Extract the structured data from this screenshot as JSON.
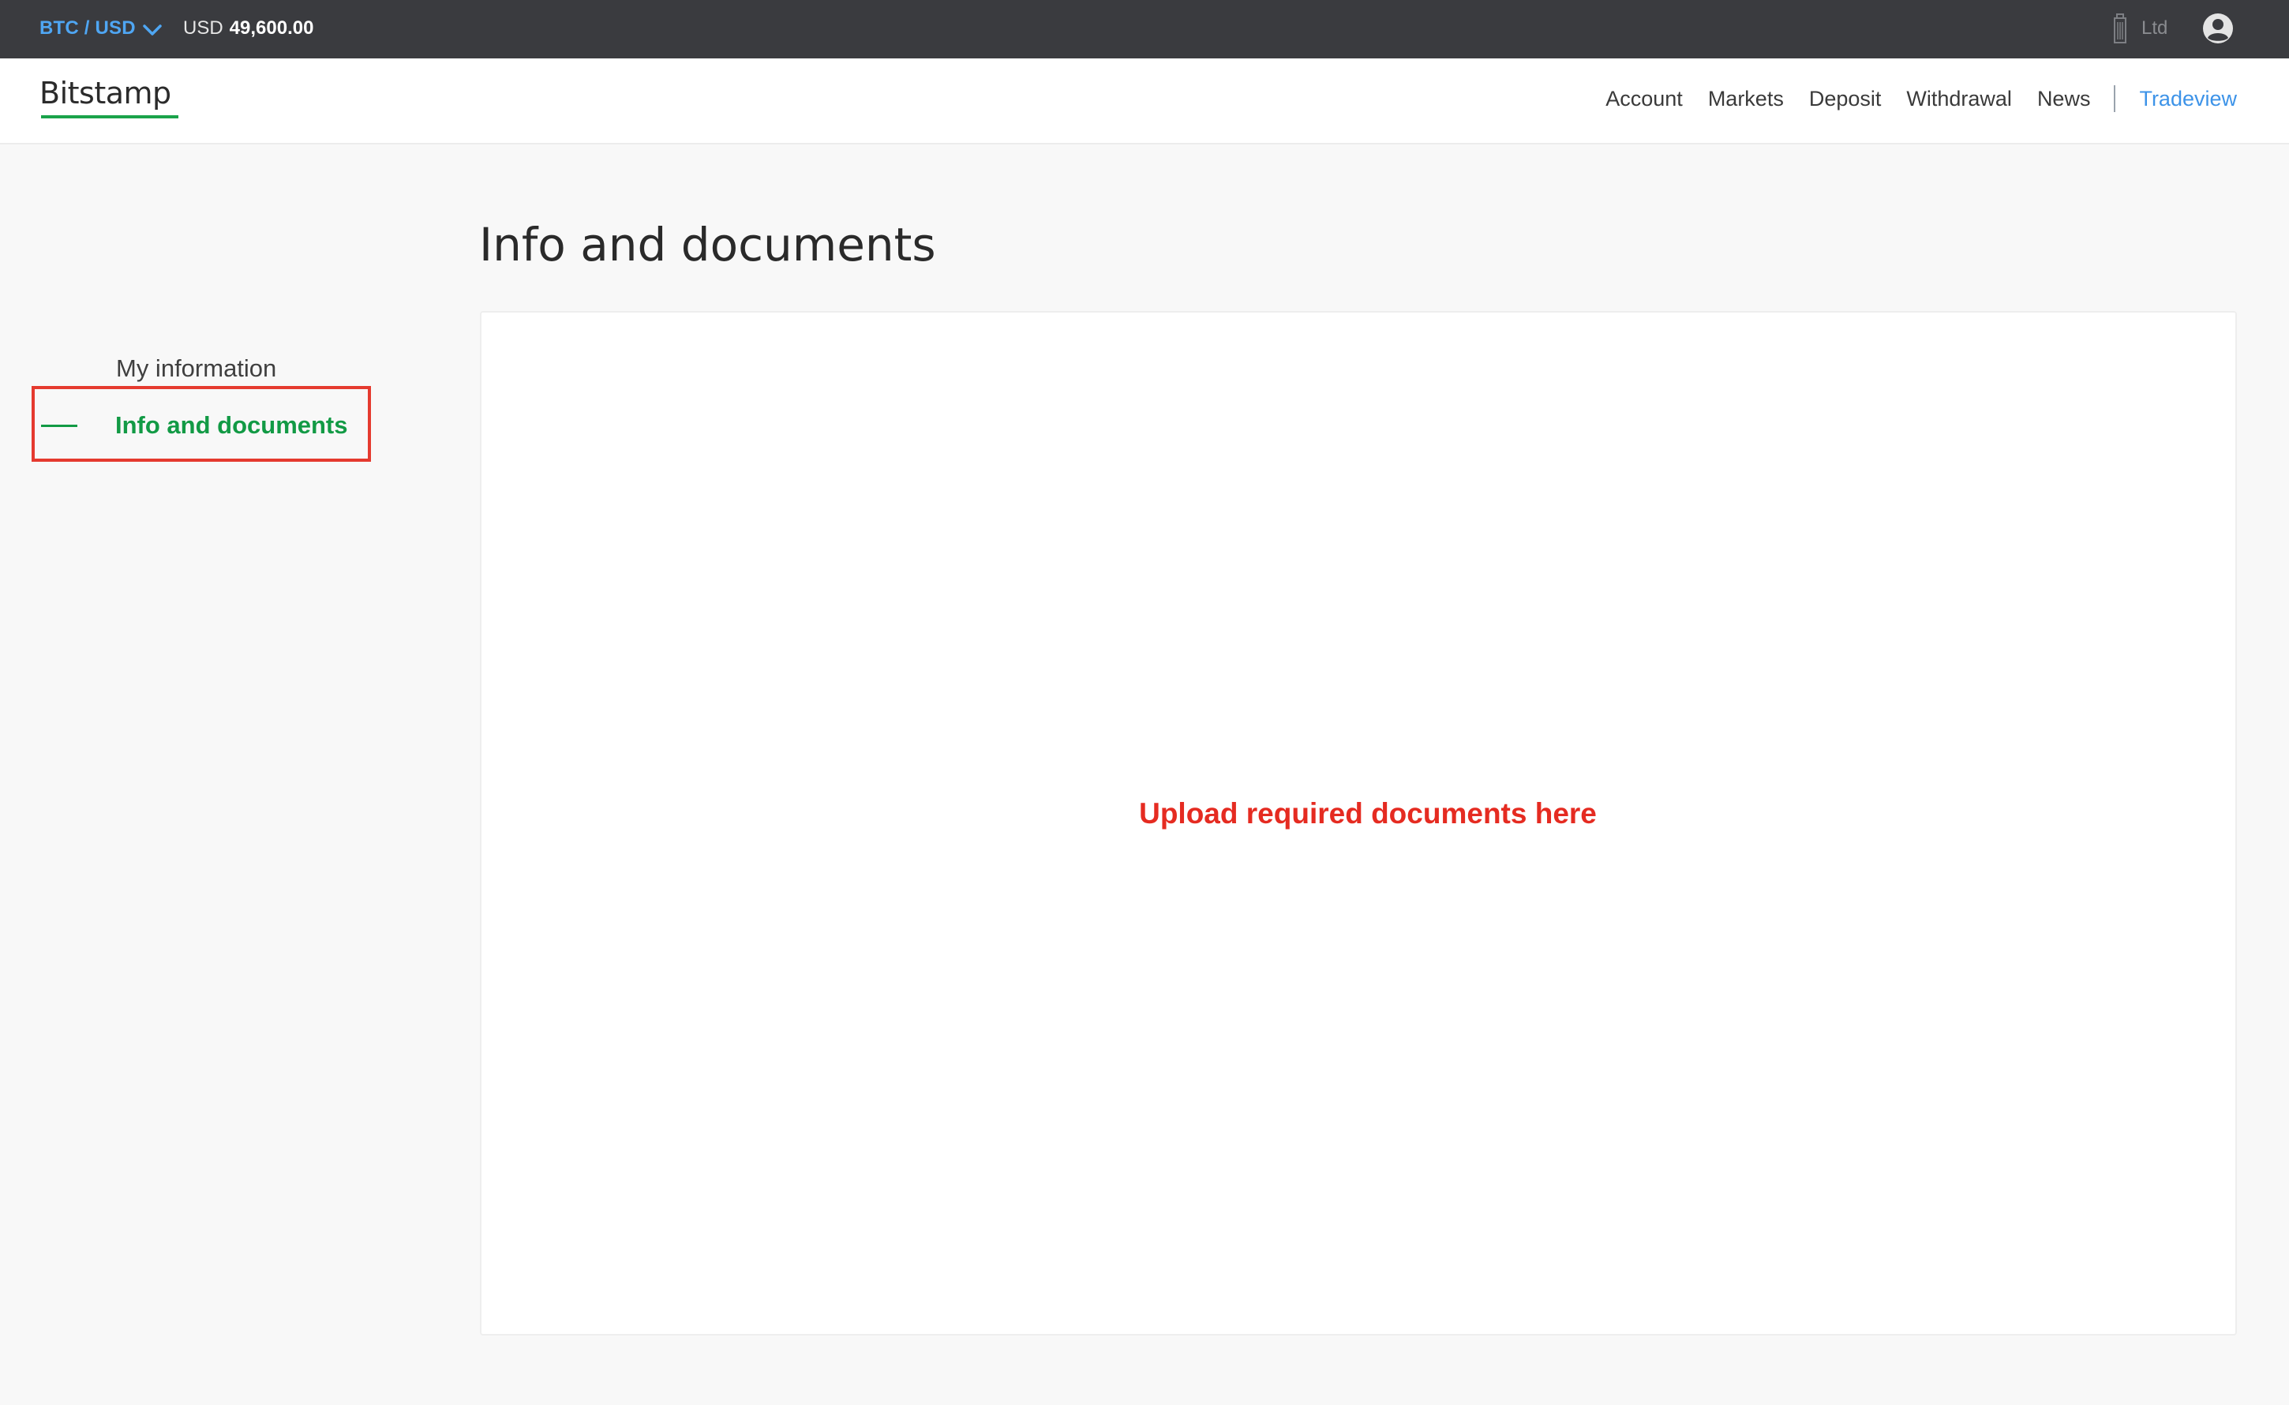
{
  "ticker": {
    "pair": "BTC / USD",
    "currency": "USD",
    "price": "49,600.00",
    "entity": "Ltd",
    "accent_color": "#4fa6f3"
  },
  "header": {
    "logo": "Bitstamp",
    "brand_color": "#1aa34a",
    "nav": {
      "account": "Account",
      "markets": "Markets",
      "deposit": "Deposit",
      "withdrawal": "Withdrawal",
      "news": "News",
      "tradeview": "Tradeview"
    }
  },
  "sidebar": {
    "items": [
      {
        "label": "My information",
        "active": false
      },
      {
        "label": "Info and documents",
        "active": true
      }
    ],
    "active_color": "#129a45"
  },
  "main": {
    "title": "Info and documents",
    "upload_note": "Upload required documents here",
    "note_color": "#e52b21"
  },
  "icons": [
    "chevron-down-icon",
    "building-icon",
    "user-account-icon"
  ]
}
